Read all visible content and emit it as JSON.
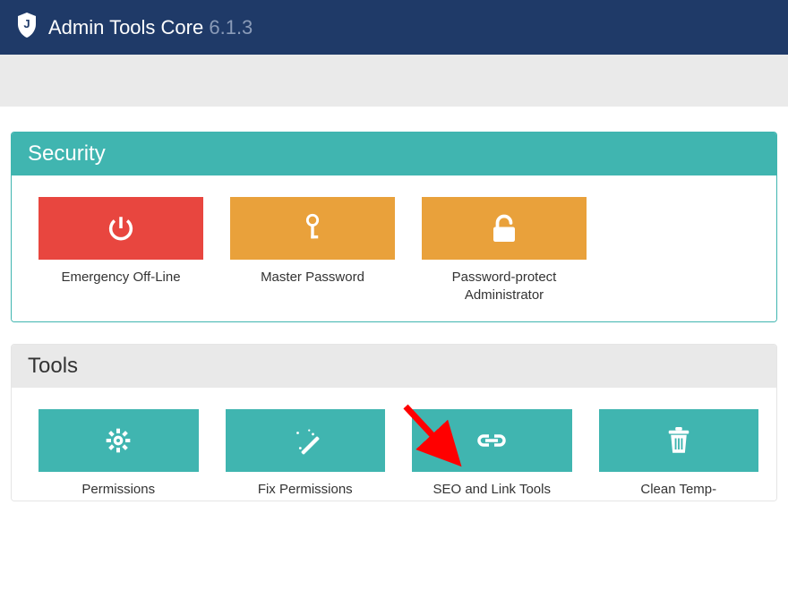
{
  "header": {
    "title": "Admin Tools Core",
    "version": "6.1.3"
  },
  "sections": {
    "security": {
      "title": "Security",
      "tiles": [
        {
          "label": "Emergency Off-Line",
          "icon": "power",
          "color": "red"
        },
        {
          "label": "Master Password",
          "icon": "key",
          "color": "yellow"
        },
        {
          "label": "Password-protect Administrator",
          "icon": "unlock",
          "color": "yellow"
        }
      ]
    },
    "tools": {
      "title": "Tools",
      "tiles": [
        {
          "label": "Permissions",
          "icon": "gear",
          "color": "teal"
        },
        {
          "label": "Fix Permissions",
          "icon": "wand",
          "color": "teal"
        },
        {
          "label": "SEO and Link Tools",
          "icon": "link",
          "color": "teal"
        },
        {
          "label": "Clean Temp-",
          "icon": "trash",
          "color": "teal"
        }
      ]
    }
  }
}
